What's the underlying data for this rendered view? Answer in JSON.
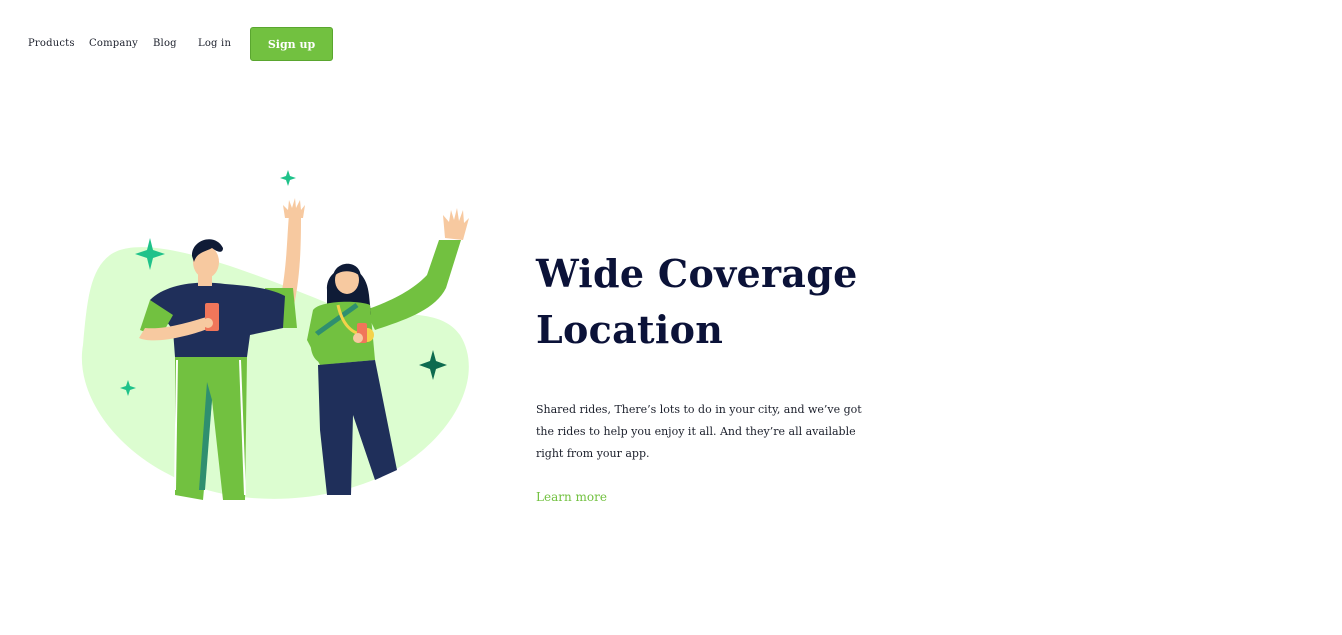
{
  "nav": {
    "items": [
      {
        "label": "Products"
      },
      {
        "label": "Company"
      },
      {
        "label": "Blog"
      },
      {
        "label": "Log in"
      }
    ],
    "signup_label": "Sign up"
  },
  "hero": {
    "title_line1": "Wide Coverage",
    "title_line2": "Location",
    "description": "Shared rides, There’s lots to do in your city, and we’ve got the rides to help you enjoy it all. And they’re all available right from your app.",
    "cta_label": "Learn more",
    "illustration": {
      "subject": "two people waving with phones",
      "icons": [
        "sparkle-icon",
        "sparkle-icon",
        "sparkle-icon",
        "sparkle-icon",
        "sparkle-icon"
      ]
    }
  },
  "colors": {
    "accent": "#72c140",
    "heading": "#0b1238",
    "blob": "#dcfdd0",
    "sparkle_teal": "#1fc28a",
    "sparkle_dark": "#0e6b4f",
    "navy": "#1f2f5a"
  }
}
